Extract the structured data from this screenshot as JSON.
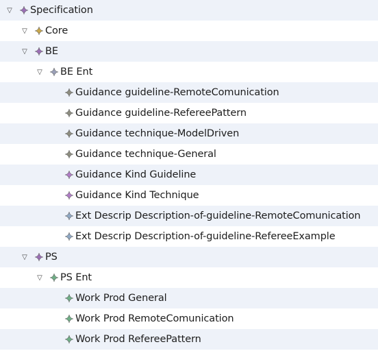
{
  "tree": {
    "nodes": [
      {
        "label": "Specification",
        "depth": 0,
        "expandable": true,
        "icon": "diamond-node-icon",
        "icon_color": "#9b6fb5"
      },
      {
        "label": "Core",
        "depth": 1,
        "expandable": true,
        "icon": "diamond-node-icon",
        "icon_color": "#c9a74a"
      },
      {
        "label": "BE",
        "depth": 1,
        "expandable": true,
        "icon": "diamond-node-icon",
        "icon_color": "#9b6fb5"
      },
      {
        "label": "BE Ent",
        "depth": 2,
        "expandable": true,
        "icon": "diamond-node-icon",
        "icon_color": "#9aa0b8"
      },
      {
        "label": "Guidance guideline-RemoteComunication",
        "depth": 3,
        "expandable": false,
        "icon": "diamond-node-icon",
        "icon_color": "#8d8d80"
      },
      {
        "label": "Guidance guideline-RefereePattern",
        "depth": 3,
        "expandable": false,
        "icon": "diamond-node-icon",
        "icon_color": "#8d8d80"
      },
      {
        "label": "Guidance technique-ModelDriven",
        "depth": 3,
        "expandable": false,
        "icon": "diamond-node-icon",
        "icon_color": "#8d8d80"
      },
      {
        "label": "Guidance technique-General",
        "depth": 3,
        "expandable": false,
        "icon": "diamond-node-icon",
        "icon_color": "#8d8d80"
      },
      {
        "label": "Guidance Kind Guideline",
        "depth": 3,
        "expandable": false,
        "icon": "diamond-node-icon",
        "icon_color": "#b07cc6"
      },
      {
        "label": "Guidance Kind Technique",
        "depth": 3,
        "expandable": false,
        "icon": "diamond-node-icon",
        "icon_color": "#b07cc6"
      },
      {
        "label": "Ext Descrip Description-of-guideline-RemoteComunication",
        "depth": 3,
        "expandable": false,
        "icon": "diamond-node-icon",
        "icon_color": "#8fa8c4"
      },
      {
        "label": "Ext Descrip Description-of-guideline-RefereeExample",
        "depth": 3,
        "expandable": false,
        "icon": "diamond-node-icon",
        "icon_color": "#8fa8c4"
      },
      {
        "label": "PS",
        "depth": 1,
        "expandable": true,
        "icon": "diamond-node-icon",
        "icon_color": "#9b6fb5"
      },
      {
        "label": "PS Ent",
        "depth": 2,
        "expandable": true,
        "icon": "diamond-node-icon",
        "icon_color": "#6fae86"
      },
      {
        "label": "Work Prod General",
        "depth": 3,
        "expandable": false,
        "icon": "diamond-node-icon",
        "icon_color": "#6fae86"
      },
      {
        "label": "Work Prod RemoteComunication",
        "depth": 3,
        "expandable": false,
        "icon": "diamond-node-icon",
        "icon_color": "#6fae86"
      },
      {
        "label": "Work Prod RefereePattern",
        "depth": 3,
        "expandable": false,
        "icon": "diamond-node-icon",
        "icon_color": "#6fae86"
      }
    ],
    "expanded_glyph": "▽"
  }
}
